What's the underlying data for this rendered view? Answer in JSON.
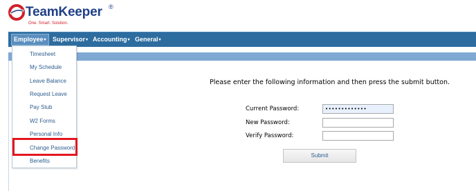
{
  "logo": {
    "name": "TeamKeeper",
    "registered": "®",
    "tagline": "One. Smart. Solution."
  },
  "nav": {
    "employee": "Employee",
    "supervisor": "Supervisor",
    "accounting": "Accounting",
    "general": "General",
    "caret": "▾"
  },
  "dropdown": {
    "items": [
      "Timesheet",
      "My Schedule",
      "Leave Balance",
      "Request Leave",
      "Pay Stub",
      "W2 Forms",
      "Personal Info",
      "Change Password",
      "Benefits"
    ],
    "highlighted": "Change Password"
  },
  "form": {
    "instruction": "Please enter the following information and then press the submit button.",
    "current_password_label": "Current Password:",
    "current_password_value": "•••••••••••••",
    "new_password_label": "New Password:",
    "new_password_value": "",
    "verify_password_label": "Verify Password:",
    "verify_password_value": "",
    "submit_label": "Submit"
  },
  "colors": {
    "navbar": "#2d6c9f",
    "subbar": "#7fa9d3",
    "highlight": "#e3161f",
    "brand": "#1f3f86",
    "tagline": "#d0202a"
  }
}
